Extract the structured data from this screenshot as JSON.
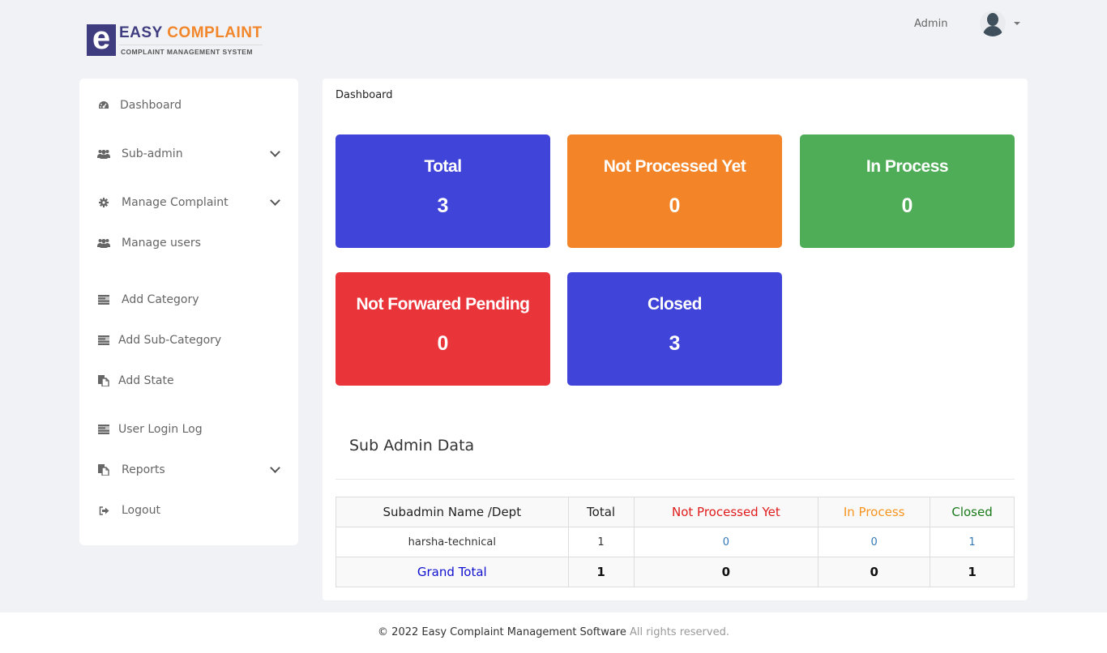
{
  "brand": {
    "logo_letter": "e",
    "title_part1": "EASY",
    "title_part2": "COMPLAINT",
    "subtitle": "COMPLAINT MANAGEMENT SYSTEM"
  },
  "user": {
    "name": "Admin"
  },
  "sidebar": {
    "items": [
      {
        "label": "Dashboard",
        "icon": "dashboard-gauge-icon",
        "has_submenu": false
      },
      {
        "label": "Sub-admin",
        "icon": "users-icon",
        "has_submenu": true
      },
      {
        "label": "Manage Complaint",
        "icon": "gear-icon",
        "has_submenu": true
      },
      {
        "label": "Manage users",
        "icon": "users-icon",
        "has_submenu": false
      },
      {
        "label": "Add Category",
        "icon": "list-icon",
        "has_submenu": false
      },
      {
        "label": "Add Sub-Category",
        "icon": "list-icon",
        "has_submenu": false
      },
      {
        "label": "Add State",
        "icon": "copy-icon",
        "has_submenu": false
      },
      {
        "label": "User Login Log",
        "icon": "list-icon",
        "has_submenu": false
      },
      {
        "label": "Reports",
        "icon": "copy-icon",
        "has_submenu": true
      },
      {
        "label": "Logout",
        "icon": "sign-out-icon",
        "has_submenu": false
      }
    ]
  },
  "main": {
    "breadcrumb": "Dashboard",
    "cards": [
      {
        "title": "Total",
        "value": "3",
        "color": "#4044d9"
      },
      {
        "title": "Not Processed Yet",
        "value": "0",
        "color": "#f38427"
      },
      {
        "title": "In Process",
        "value": "0",
        "color": "#4fac57"
      },
      {
        "title": "Not Forwared Pending",
        "value": "0",
        "color": "#e9343a"
      },
      {
        "title": "Closed",
        "value": "3",
        "color": "#4044d9"
      }
    ],
    "section_title": "Sub Admin Data",
    "table": {
      "headers": [
        {
          "label": "Subadmin Name /Dept",
          "color": "#222222"
        },
        {
          "label": "Total",
          "color": "#222222"
        },
        {
          "label": "Not Processed Yet",
          "color": "#e01b1b"
        },
        {
          "label": "In Process",
          "color": "#f7941d"
        },
        {
          "label": "Closed",
          "color": "#1a7a1a"
        }
      ],
      "rows": [
        {
          "name": "harsha-technical",
          "total": "1",
          "not_processed": "0",
          "in_process": "0",
          "closed": "1"
        }
      ],
      "grand_total": {
        "label": "Grand Total",
        "total": "1",
        "not_processed": "0",
        "in_process": "0",
        "closed": "1"
      }
    }
  },
  "footer": {
    "brand": "© 2022 Easy Complaint Management Software",
    "rights": "All rights reserved."
  }
}
